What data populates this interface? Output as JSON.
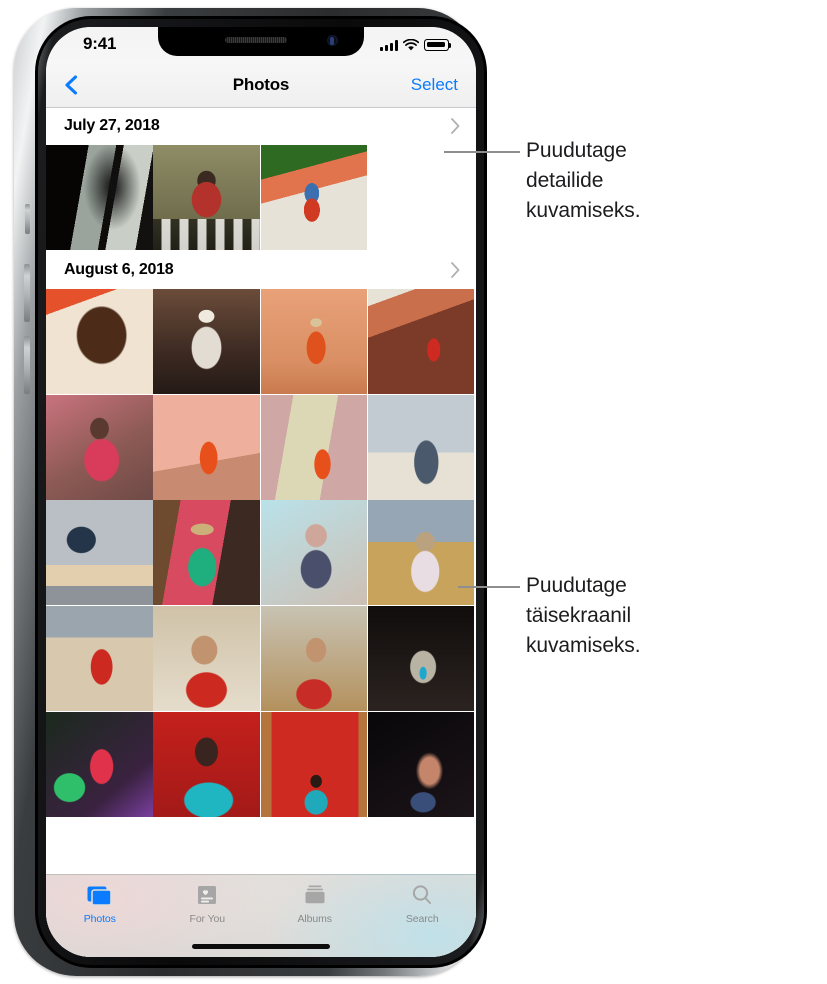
{
  "device": {
    "name": "iphone-x",
    "frame_color": "#2a2c2e"
  },
  "status_bar": {
    "time": "9:41",
    "cellular_icon": "signal-bars-icon",
    "wifi_icon": "wifi-icon",
    "battery_icon": "battery-full-icon"
  },
  "nav_bar": {
    "back_icon": "chevron-left-icon",
    "title": "Photos",
    "action_label": "Select",
    "accent_color": "#0b7bff"
  },
  "sections": [
    {
      "title": "July 27, 2018",
      "chevron_icon": "chevron-right-icon",
      "rows": [
        [
          {
            "alt": "silhouette-of-woman-by-window",
            "c1": "#0a0807",
            "c2": "#1a1511",
            "c3": "#cfd2cc",
            "c4": "#2a211a"
          },
          {
            "alt": "woman-in-red-shirt-at-checkered-table",
            "c1": "#8c8a62",
            "c2": "#b4322c",
            "c3": "#e8e4dc",
            "c4": "#201d16"
          },
          {
            "alt": "child-in-blue-and-red-dress-on-steps",
            "c1": "#2f6a22",
            "c2": "#e2744d",
            "c3": "#3b6fb0",
            "c4": "#d9d4c9"
          }
        ]
      ]
    },
    {
      "title": "August 6, 2018",
      "chevron_icon": "chevron-right-icon",
      "rows": [
        [
          {
            "alt": "portrait-woman-with-curly-hair",
            "c1": "#e4512a",
            "c2": "#4c2b18",
            "c3": "#c79a62",
            "c4": "#f0e3d2"
          },
          {
            "alt": "person-in-patterned-robe-in-alley",
            "c1": "#3d2a22",
            "c2": "#b8a48f",
            "c3": "#e3dcd2",
            "c4": "#6b4c3a"
          },
          {
            "alt": "boy-in-orange-shirt-playing",
            "c1": "#e9a179",
            "c2": "#e0521d",
            "c3": "#d98f63",
            "c4": "#c97a4e"
          },
          {
            "alt": "woman-in-red-against-red-dunes",
            "c1": "#7c3b29",
            "c2": "#c96f4c",
            "c3": "#e6e2d6",
            "c4": "#9e4e33"
          }
        ],
        [
          {
            "alt": "woman-in-pink-dress-sitting",
            "c1": "#c9737e",
            "c2": "#d93b5a",
            "c3": "#8d5a55",
            "c4": "#e8c5c3"
          },
          {
            "alt": "boy-juggling-against-pink-wall",
            "c1": "#eeb09c",
            "c2": "#e8501b",
            "c3": "#dfa290",
            "c4": "#c98a72"
          },
          {
            "alt": "boy-juggling-balls-green-wall",
            "c1": "#dcd8b6",
            "c2": "#e8501b",
            "c3": "#cfa8a6",
            "c4": "#b7c09a"
          },
          {
            "alt": "person-with-hat-in-striped-shirt",
            "c1": "#c3cbd2",
            "c2": "#4a5a6c",
            "c3": "#e6e1d4",
            "c4": "#2e3a47"
          }
        ],
        [
          {
            "alt": "figure-with-cloth-at-dusk",
            "c1": "#b9bfc4",
            "c2": "#24354a",
            "c3": "#e3cfae",
            "c4": "#8e9299"
          },
          {
            "alt": "man-in-green-shirt-with-straw-hat",
            "c1": "#1fae7e",
            "c2": "#6e4a2e",
            "c3": "#d84a5f",
            "c4": "#2e8f63"
          },
          {
            "alt": "older-man-in-flat-cap",
            "c1": "#b9e2ea",
            "c2": "#4a4f6b",
            "c3": "#cfa79a",
            "c4": "#8f9aa8"
          },
          {
            "alt": "smiling-girl-in-embroidered-tunic",
            "c1": "#e8dde2",
            "c2": "#c7a35c",
            "c3": "#97a6b5",
            "c4": "#bba27f"
          }
        ],
        [
          {
            "alt": "woman-in-red-top-by-taxi",
            "c1": "#d8c9ae",
            "c2": "#cc2a20",
            "c3": "#9aa5ad",
            "c4": "#e0d3bb"
          },
          {
            "alt": "woman-in-red-sweater-portrait",
            "c1": "#cfc2a8",
            "c2": "#cc2a20",
            "c3": "#e5dccb",
            "c4": "#7d6a56"
          },
          {
            "alt": "woman-in-embroidered-red-dress",
            "c1": "#c8c3b4",
            "c2": "#c72c26",
            "c3": "#b4915d",
            "c4": "#6b5a4a"
          },
          {
            "alt": "figure-in-blue-in-dark-doorway",
            "c1": "#100d0c",
            "c2": "#2b2320",
            "c3": "#1fa8cf",
            "c4": "#b9b3a4"
          }
        ],
        [
          {
            "alt": "woman-with-colored-lights",
            "c1": "#1b2a1d",
            "c2": "#e0324a",
            "c3": "#2fbf6a",
            "c4": "#7a3fa0"
          },
          {
            "alt": "man-in-teal-robe-against-red",
            "c1": "#c4201c",
            "c2": "#1fb6c2",
            "c3": "#3a2420",
            "c4": "#d93b2a"
          },
          {
            "alt": "boy-in-teal-robe-before-red-cloth",
            "c1": "#cf2a22",
            "c2": "#1fa9bb",
            "c3": "#b4743c",
            "c4": "#e04a33"
          },
          {
            "alt": "woman-in-profile-in-dark-light",
            "c1": "#08070a",
            "c2": "#2a1f22",
            "c3": "#c4856a",
            "c4": "#3a4e7a"
          }
        ]
      ]
    }
  ],
  "tab_bar": {
    "items": [
      {
        "label": "Photos",
        "icon": "photos-stack-icon",
        "active": true
      },
      {
        "label": "For You",
        "icon": "for-you-card-icon",
        "active": false
      },
      {
        "label": "Albums",
        "icon": "albums-stack-icon",
        "active": false
      },
      {
        "label": "Search",
        "icon": "search-magnifier-icon",
        "active": false
      }
    ],
    "active_color": "#0b7bff",
    "inactive_color": "#8a8a8a"
  },
  "callouts": [
    {
      "id": "callout-details",
      "line1": "Puudutage",
      "line2": "detailide",
      "line3": "kuvamiseks."
    },
    {
      "id": "callout-fullscreen",
      "line1": "Puudutage",
      "line2": "täisekraanil",
      "line3": "kuvamiseks."
    }
  ]
}
